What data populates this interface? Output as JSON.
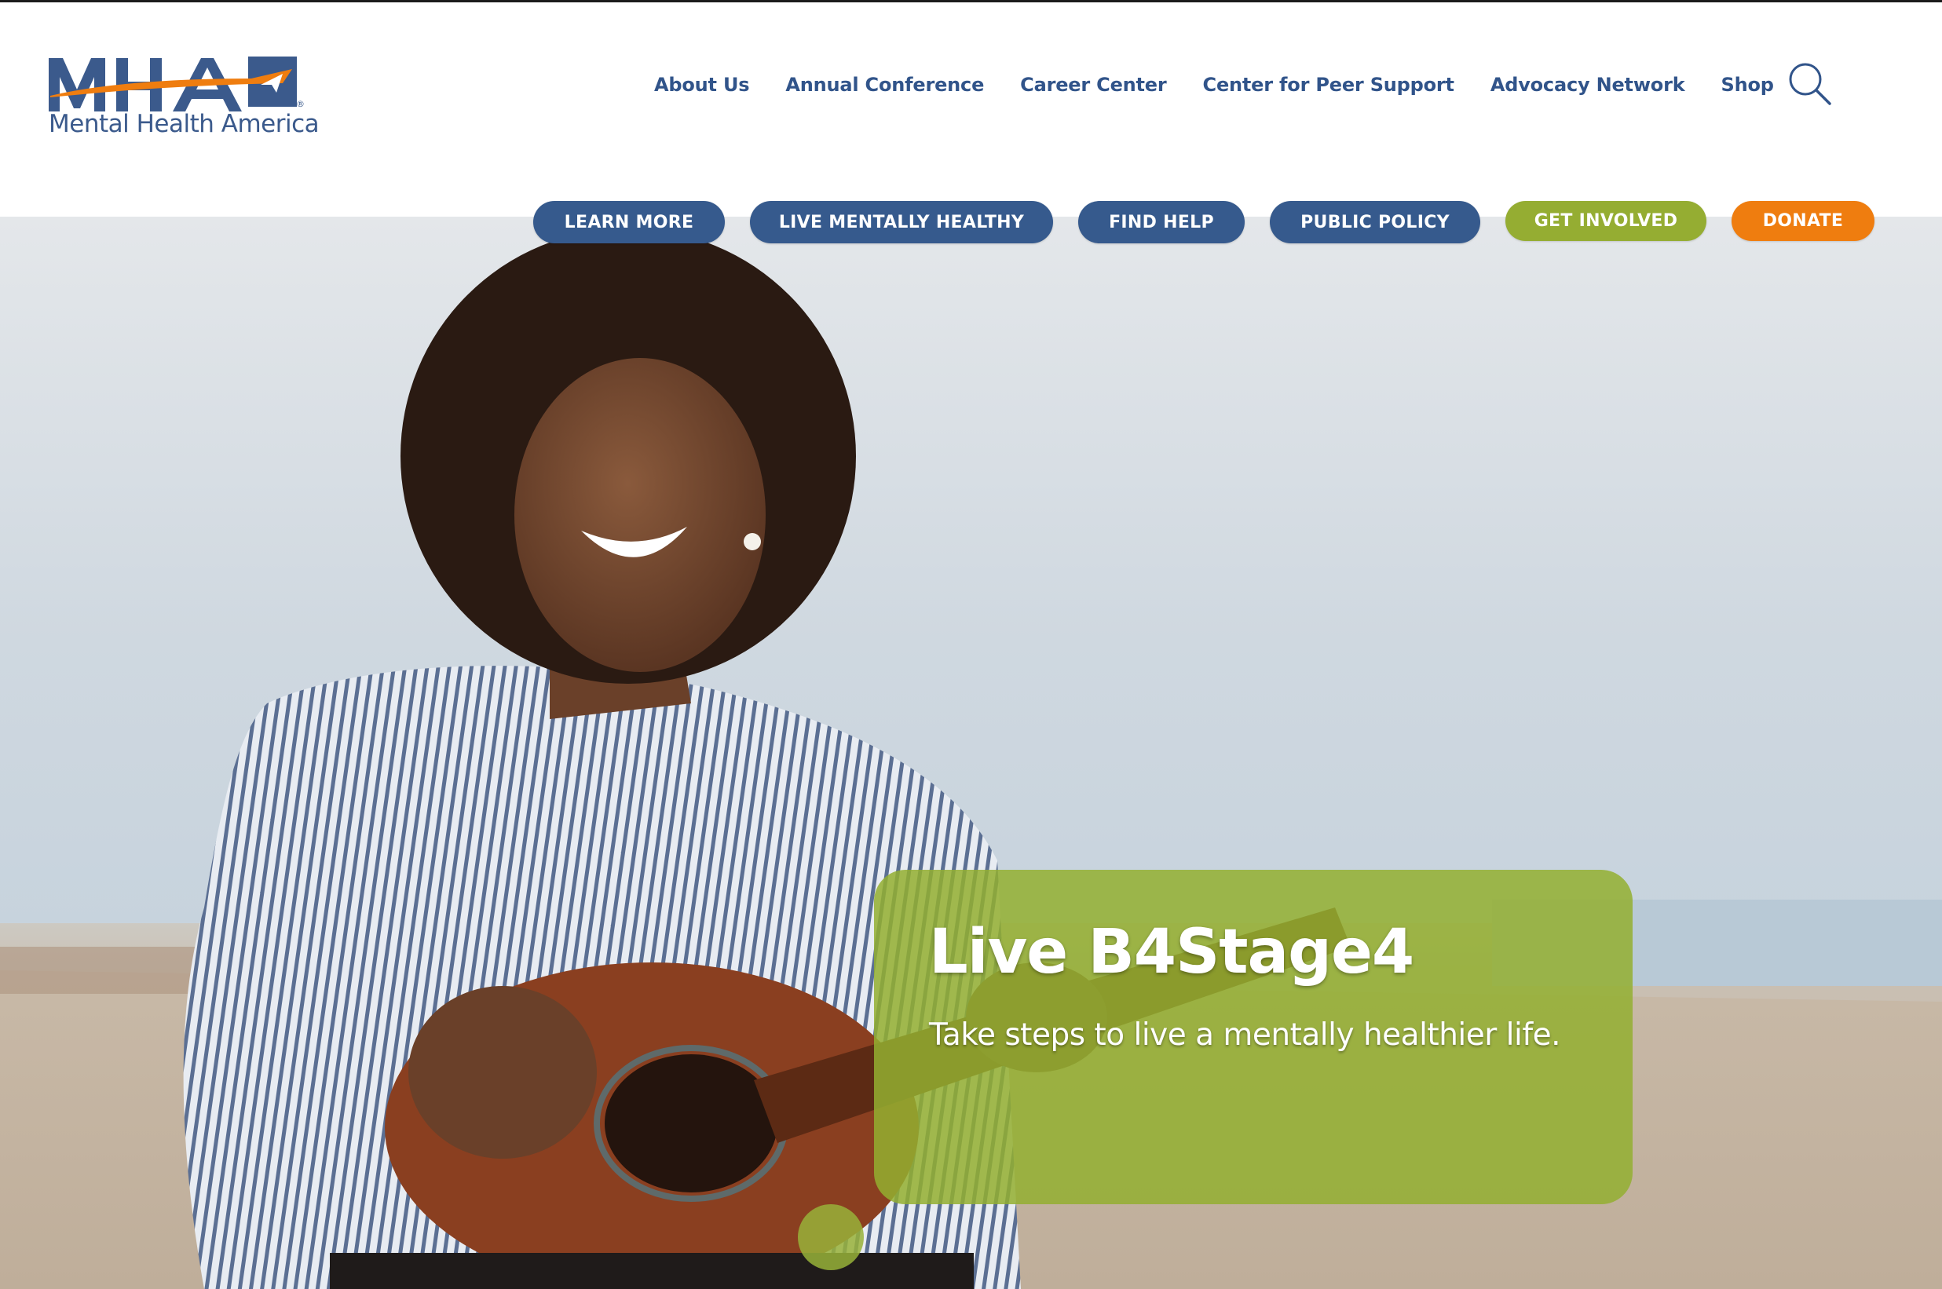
{
  "brand": {
    "logo_letters": "MHA",
    "name": "Mental Health America",
    "colors": {
      "navy": "#31548a",
      "orange": "#ef7d0f",
      "green": "#95ad32"
    }
  },
  "main_nav": {
    "items": [
      {
        "label": "About Us"
      },
      {
        "label": "Annual Conference"
      },
      {
        "label": "Career Center"
      },
      {
        "label": "Center for Peer Support"
      },
      {
        "label": "Advocacy Network"
      },
      {
        "label": "Shop"
      }
    ],
    "search_icon": "search-icon"
  },
  "action_nav": {
    "learn_more": "LEARN MORE",
    "live_mentally_healthy": "LIVE MENTALLY HEALTHY",
    "find_help": "FIND HELP",
    "public_policy": "PUBLIC POLICY",
    "get_involved": "GET INVOLVED",
    "donate": "DONATE"
  },
  "hero": {
    "title": "Live B4Stage4",
    "subtitle": "Take steps to live a mentally healthier life."
  }
}
